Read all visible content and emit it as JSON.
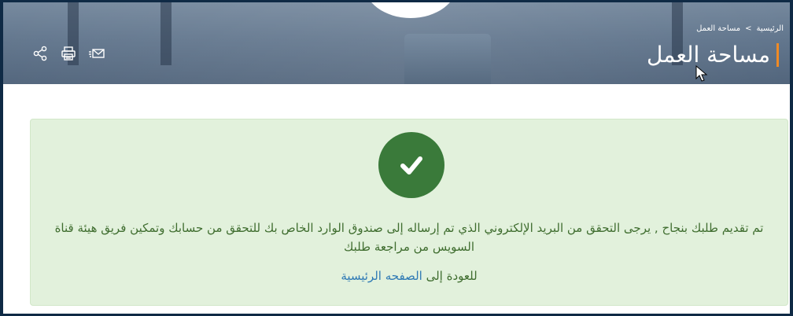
{
  "breadcrumb": {
    "home": "الرئيسية",
    "separator": ">",
    "current": "مساحة العمل"
  },
  "page_title": "مساحة العمل",
  "toolbar": {
    "share_icon": "share-icon",
    "print_icon": "print-icon",
    "email_icon": "email-icon"
  },
  "success": {
    "message": "تم تقديم طلبك بنجاح , يرجى التحقق من البريد الإلكتروني الذي تم إرساله إلى صندوق الوارد الخاص بك للتحقق من حسابك وتمكين فريق هيئة قناة السويس من مراجعة طلبك",
    "back_prefix": "للعودة إلى",
    "back_link": "الصفحه الرئيسية"
  },
  "colors": {
    "accent": "#f08a24",
    "success_bg": "#e2f1dc",
    "check_green": "#3a7a3a",
    "link": "#2f7ab5"
  }
}
